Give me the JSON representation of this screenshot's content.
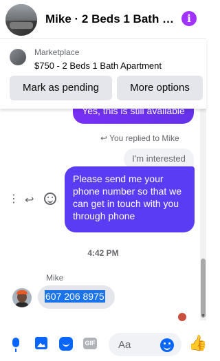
{
  "header": {
    "title": "Mike · 2 Beds 1 Bath …",
    "info_glyph": "i",
    "avatar_icon": "listing-photo",
    "accent_color": "#a033ff"
  },
  "marketplace": {
    "label": "Marketplace",
    "listing": "$750 - 2 Beds 1 Bath Apartment",
    "mark_pending_label": "Mark as pending",
    "more_options_label": "More options"
  },
  "messages": {
    "out_partial": "Yes, this is still available",
    "replied_label": "You replied to Mike",
    "quoted_text": "I'm interested",
    "out_main": "Please send me your phone  number so that we can get in touch with you through phone",
    "timestamp": "4:42 PM",
    "sender_name": "Mike",
    "in_text": "607 206 8975",
    "bubble_color": "#5b3cf5"
  },
  "composer": {
    "placeholder": "Aa",
    "gif_label": "GIF",
    "like_glyph": "👍",
    "accent_color": "#0866ff"
  }
}
